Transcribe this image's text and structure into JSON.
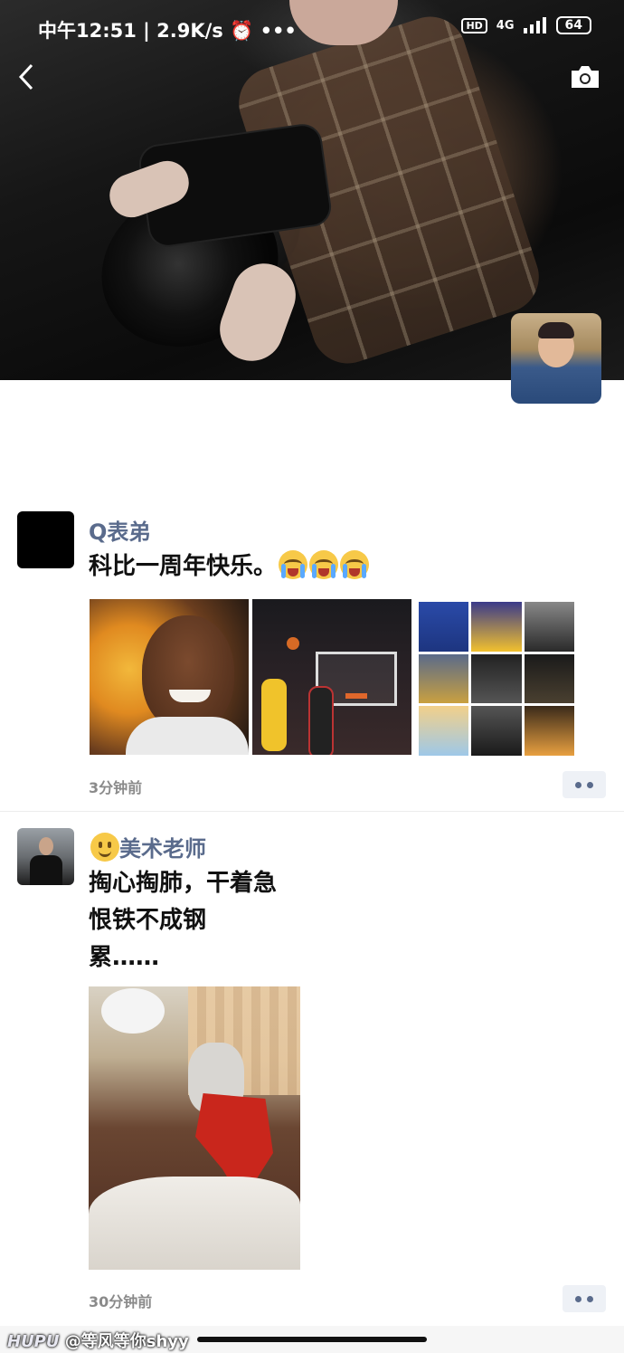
{
  "status_bar": {
    "time": "中午12:51",
    "net_speed": "2.9K/s",
    "hd": "HD",
    "network": "4G",
    "battery": "64"
  },
  "cover": {
    "back_icon": "chevron-left-icon",
    "camera_icon": "camera-icon"
  },
  "posts": [
    {
      "name": "Q表弟",
      "text": "科比一周年快乐。",
      "time": "3分钟前",
      "emoji": "crying-face"
    },
    {
      "name": "美术老师",
      "name_emoji": "smiling-face",
      "lines": [
        "掏心掏肺，干着急",
        "恨铁不成钢",
        "累……"
      ],
      "time": "30分钟前"
    }
  ],
  "watermark": {
    "brand": "HUPU",
    "handle": "@等风等你shyy"
  },
  "colors": {
    "name": "#5a6b8c",
    "timestamp": "#8a8a8a"
  }
}
